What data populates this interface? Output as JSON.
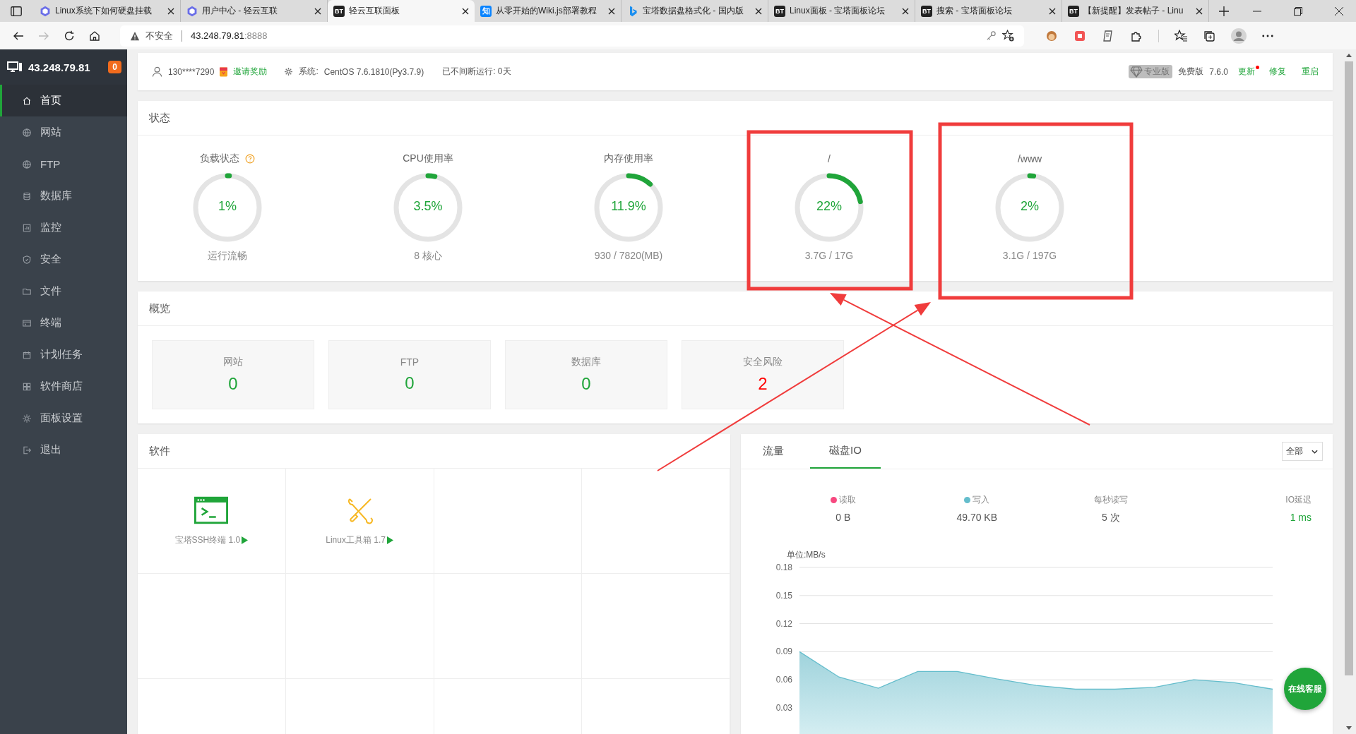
{
  "browser": {
    "tabs": [
      {
        "title": "Linux系统下如何硬盘挂载",
        "kind": "logo",
        "selected": false
      },
      {
        "title": "用户中心 - 轻云互联",
        "kind": "logo",
        "selected": false
      },
      {
        "title": "轻云互联面板",
        "kind": "letters",
        "favicon": "BT",
        "selected": true
      },
      {
        "title": "从零开始的Wiki.js部署教程",
        "kind": "letters",
        "favicon": "知",
        "selected": false
      },
      {
        "title": "宝塔数据盘格式化 - 国内版",
        "kind": "search",
        "selected": false
      },
      {
        "title": "Linux面板 - 宝塔面板论坛",
        "kind": "letters",
        "favicon": "BT",
        "selected": false
      },
      {
        "title": "搜索 - 宝塔面板论坛",
        "kind": "letters",
        "favicon": "BT",
        "selected": false
      },
      {
        "title": "【新提醒】发表帖子 - Linu",
        "kind": "letters",
        "favicon": "BT",
        "selected": false
      }
    ],
    "address": {
      "warning": "不安全",
      "host": "43.248.79.81",
      "port": ":8888"
    }
  },
  "sidebar": {
    "host": "43.248.79.81",
    "badge": "0",
    "items": [
      {
        "label": "首页",
        "selected": true
      },
      {
        "label": "网站",
        "selected": false
      },
      {
        "label": "FTP",
        "selected": false
      },
      {
        "label": "数据库",
        "selected": false
      },
      {
        "label": "监控",
        "selected": false
      },
      {
        "label": "安全",
        "selected": false
      },
      {
        "label": "文件",
        "selected": false
      },
      {
        "label": "终端",
        "selected": false
      },
      {
        "label": "计划任务",
        "selected": false
      },
      {
        "label": "软件商店",
        "selected": false
      },
      {
        "label": "面板设置",
        "selected": false
      },
      {
        "label": "退出",
        "selected": false
      }
    ]
  },
  "header": {
    "user": "130****7290",
    "invite": "邀请奖励",
    "system_label": "系统:",
    "system": "CentOS 7.6.1810(Py3.7.9)",
    "uptime": "已不间断运行: 0天",
    "pro": "专业版",
    "edition": "免费版",
    "version": "7.6.0",
    "actions": [
      {
        "label": "更新",
        "notify": true
      },
      {
        "label": "修复",
        "notify": false
      },
      {
        "label": "重启",
        "notify": false
      }
    ]
  },
  "status": {
    "title": "状态",
    "gauges": [
      {
        "label": "负载状态",
        "help": true,
        "value": "1%",
        "level": 0.01,
        "caption": "运行流畅"
      },
      {
        "label": "CPU使用率",
        "help": false,
        "value": "3.5%",
        "level": 0.035,
        "caption": "8 核心"
      },
      {
        "label": "内存使用率",
        "help": false,
        "value": "11.9%",
        "level": 0.119,
        "caption": "930 / 7820(MB)"
      },
      {
        "label": "/",
        "help": false,
        "value": "22%",
        "level": 0.22,
        "caption": "3.7G / 17G"
      },
      {
        "label": "/www",
        "help": false,
        "value": "2%",
        "level": 0.02,
        "caption": "3.1G / 197G"
      }
    ]
  },
  "overview": {
    "title": "概览",
    "cards": [
      {
        "label": "网站",
        "value": "0",
        "warning": false
      },
      {
        "label": "FTP",
        "value": "0",
        "warning": false
      },
      {
        "label": "数据库",
        "value": "0",
        "warning": false
      },
      {
        "label": "安全风险",
        "value": "2",
        "warning": true
      }
    ]
  },
  "software": {
    "title": "软件",
    "items": [
      {
        "name": "宝塔SSH终端 1.0"
      },
      {
        "name": "Linux工具箱 1.7"
      }
    ]
  },
  "monitor": {
    "tabs": [
      {
        "label": "流量",
        "selected": false
      },
      {
        "label": "磁盘IO",
        "selected": true
      }
    ],
    "select": "全部",
    "stats": [
      {
        "label": "读取",
        "color": "#f7487f",
        "value": "0 B",
        "good": false
      },
      {
        "label": "写入",
        "color": "#64bdcc",
        "value": "49.70 KB",
        "good": false
      },
      {
        "label": "每秒读写",
        "value": "5 次",
        "good": false
      },
      {
        "label": "IO延迟",
        "value": "1 ms",
        "good": true
      }
    ],
    "chart_data": {
      "type": "area",
      "grid": true,
      "ylabel": "单位:MB/s",
      "ylim": [
        0,
        0.18
      ],
      "yticks": [
        0.03,
        0.06,
        0.09,
        0.12,
        0.15,
        0.18
      ],
      "series": [
        {
          "color": "#64bdcc",
          "values": [
            0.09,
            0.063,
            0.051,
            0.069,
            0.069,
            0.061,
            0.054,
            0.05,
            0.05,
            0.052,
            0.06,
            0.057,
            0.05
          ]
        }
      ]
    }
  },
  "chat_button": "在线客服"
}
